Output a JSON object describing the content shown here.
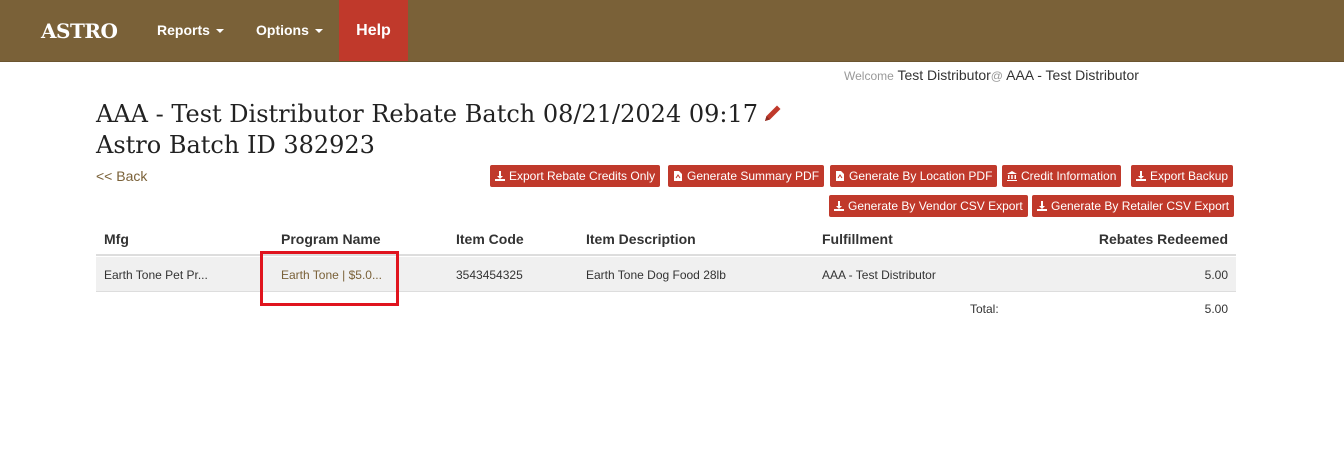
{
  "nav": {
    "brand": "ASTRO",
    "reports": "Reports",
    "options": "Options",
    "help": "Help"
  },
  "welcome": {
    "label": "Welcome",
    "user": "Test Distributor",
    "at": "@",
    "org": "AAA - Test Distributor"
  },
  "page": {
    "title": "AAA - Test Distributor Rebate Batch 08/21/2024 09:17",
    "subtitle": "Astro Batch ID 382923",
    "back": "<< Back"
  },
  "buttons": {
    "export_rebate_credits": "Export Rebate Credits Only",
    "summary_pdf": "Generate Summary PDF",
    "location_pdf": "Generate By Location PDF",
    "credit_info": "Credit Information",
    "export_backup": "Export Backup",
    "vendor_csv": "Generate By Vendor CSV Export",
    "retailer_csv": "Generate By Retailer CSV Export"
  },
  "table": {
    "headers": [
      "Mfg",
      "Program Name",
      "Item Code",
      "Item Description",
      "Fulfillment",
      "Rebates Redeemed"
    ],
    "rows": [
      [
        "Earth Tone Pet Pr...",
        "Earth Tone | $5.0...",
        "3543454325",
        "Earth Tone Dog Food 28lb",
        "AAA - Test Distributor",
        "5.00"
      ]
    ],
    "total_label": "Total:",
    "total_value": "5.00"
  },
  "colors": {
    "navbar": "#7a6138",
    "accent": "#c0392b",
    "highlight": "#e0141e"
  }
}
